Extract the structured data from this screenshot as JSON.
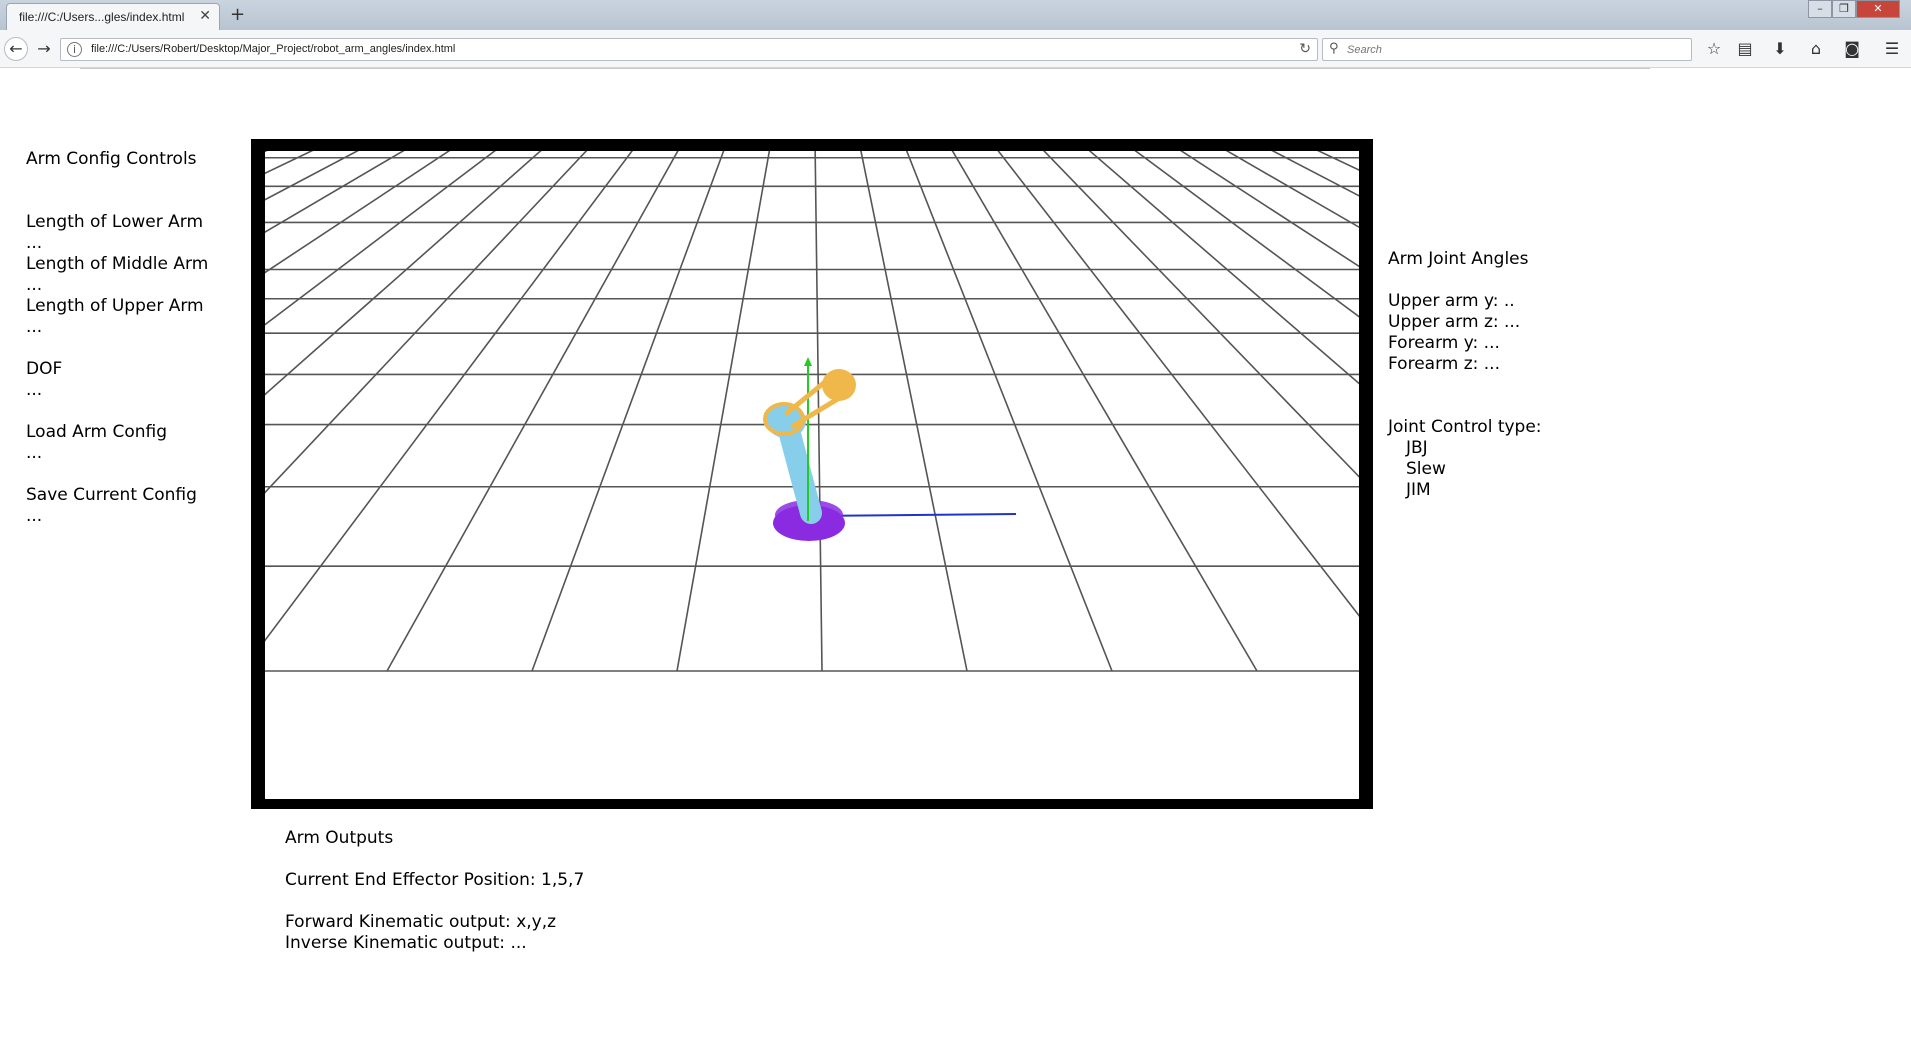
{
  "browser": {
    "tab_title": "file:///C:/Users...gles/index.html",
    "url": "file:///C:/Users/Robert/Desktop/Major_Project/robot_arm_angles/index.html",
    "search_placeholder": "Search",
    "icons": [
      "back-icon",
      "forward-icon",
      "info-icon",
      "reload-icon",
      "search-icon",
      "bookmark-star-icon",
      "reading-list-icon",
      "download-icon",
      "home-icon",
      "pocket-icon",
      "menu-icon"
    ]
  },
  "left_panel": {
    "title": "Arm Config Controls",
    "items": [
      {
        "label": "Length of Lower Arm",
        "value": "..."
      },
      {
        "label": "Length of Middle Arm",
        "value": "..."
      },
      {
        "label": "Length of Upper Arm",
        "value": "..."
      },
      {
        "label": "DOF",
        "value": "..."
      },
      {
        "label": "Load Arm Config",
        "value": "..."
      },
      {
        "label": "Save Current Config",
        "value": "..."
      }
    ]
  },
  "right_panel": {
    "title": "Arm Joint Angles",
    "angles": [
      "Upper arm y: ..",
      "Upper arm z: ...",
      "Forearm y: ...",
      "Forearm z: ..."
    ],
    "control_title": "Joint Control type:",
    "control_types": [
      "JBJ",
      "Slew",
      "JIM"
    ]
  },
  "outputs": {
    "title": "Arm Outputs",
    "end_effector": "Current End Effector Position: 1,5,7",
    "forward": "Forward Kinematic output: x,y,z",
    "inverse": "Inverse Kinematic output: ..."
  },
  "scene": {
    "base_color": "#8a2be2",
    "lower_arm_color": "#87ceeb",
    "upper_arm_color": "#f0b84a",
    "axis_colors": {
      "y": "#22cc22",
      "x": "#dd2222",
      "z": "#2233cc"
    },
    "grid_color": "#555555"
  }
}
